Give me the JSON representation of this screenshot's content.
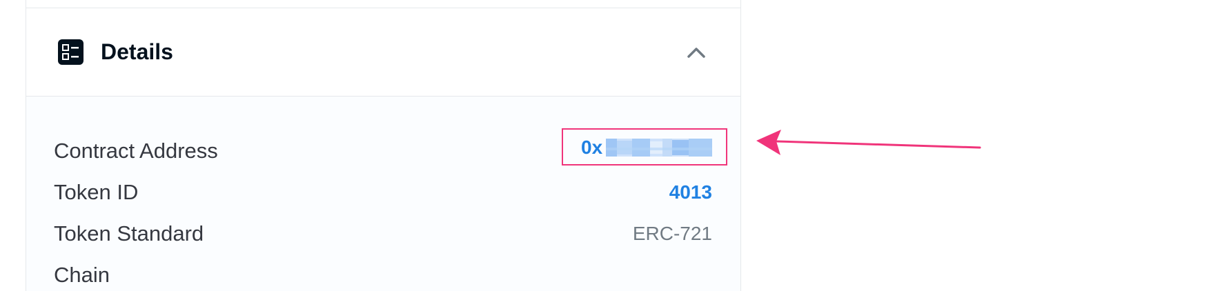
{
  "details": {
    "title": "Details",
    "expanded": true,
    "rows": [
      {
        "label": "Contract Address",
        "value": "0x"
      },
      {
        "label": "Token ID",
        "value": "4013"
      },
      {
        "label": "Token Standard",
        "value": "ERC-721"
      },
      {
        "label": "Chain",
        "value": ""
      }
    ]
  },
  "colors": {
    "link": "#2081e2",
    "highlight": "#f0347a",
    "text": "#353840",
    "muted": "#707a83"
  },
  "icons": {
    "header": "details-list-icon",
    "toggle": "chevron-up-icon"
  }
}
